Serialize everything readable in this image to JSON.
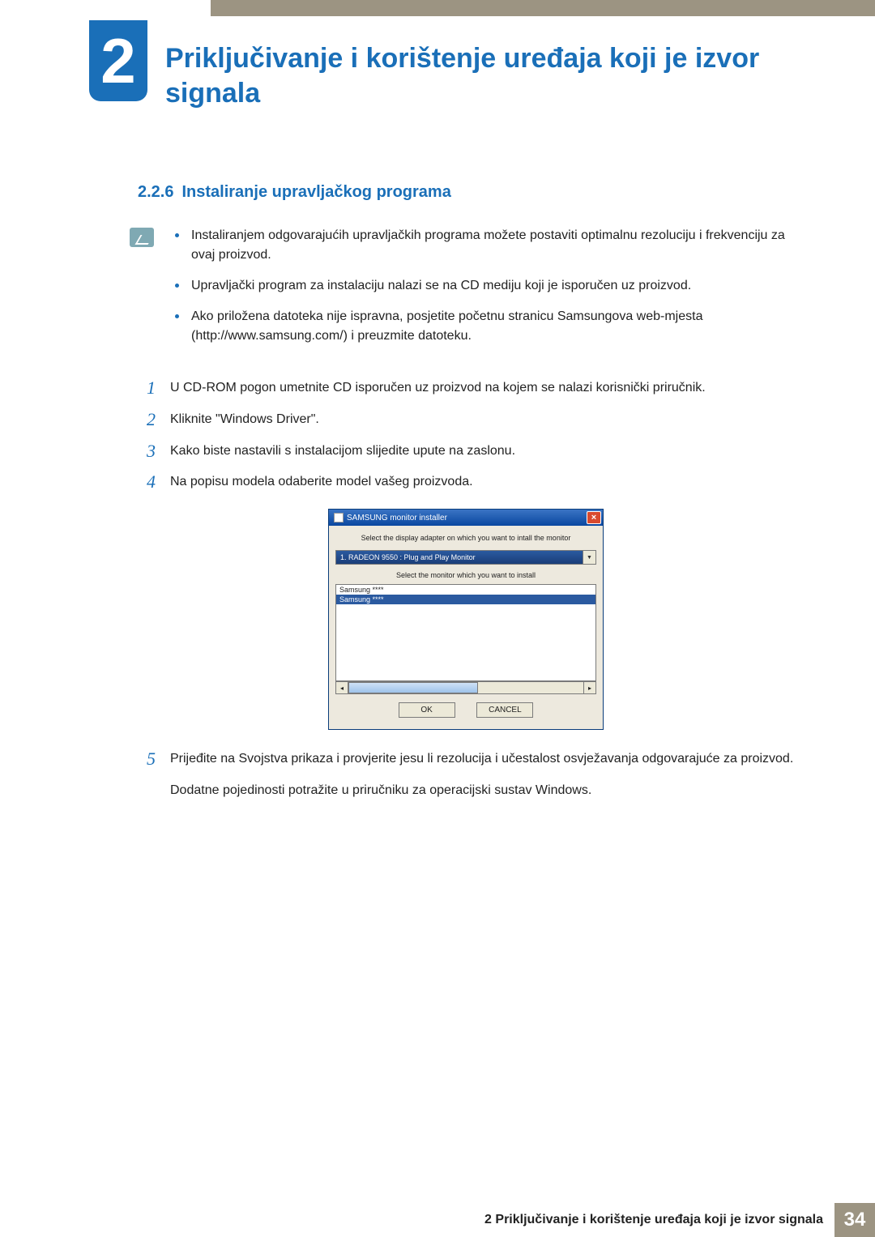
{
  "chapter": {
    "number": "2",
    "title": "Priključivanje i korištenje uređaja koji je izvor signala"
  },
  "section": {
    "number": "2.2.6",
    "title": "Instaliranje upravljačkog programa"
  },
  "note_bullets": [
    "Instaliranjem odgovarajućih upravljačkih programa možete postaviti optimalnu rezoluciju i frekvenciju za ovaj proizvod.",
    "Upravljački program za instalaciju nalazi se na CD mediju koji je isporučen uz proizvod.",
    "Ako priložena datoteka nije ispravna, posjetite početnu stranicu Samsungova web-mjesta (http://www.samsung.com/) i preuzmite datoteku."
  ],
  "steps": [
    {
      "n": "1",
      "text": "U CD-ROM pogon umetnite CD isporučen uz proizvod na kojem se nalazi korisnički priručnik."
    },
    {
      "n": "2",
      "text": "Kliknite \"Windows Driver\"."
    },
    {
      "n": "3",
      "text": "Kako biste nastavili s instalacijom slijedite upute na zaslonu."
    },
    {
      "n": "4",
      "text": "Na popisu modela odaberite model vašeg proizvoda."
    },
    {
      "n": "5",
      "text": "Prijeđite na Svojstva prikaza i provjerite jesu li rezolucija i učestalost osvježavanja odgovarajuće za proizvod."
    },
    {
      "n": "",
      "text": "Dodatne pojedinosti potražite u priručniku za operacijski sustav Windows."
    }
  ],
  "installer": {
    "title": "SAMSUNG monitor installer",
    "label1": "Select the display adapter on which you want to intall the monitor",
    "select_value": "1. RADEON 9550 : Plug and Play Monitor",
    "label2": "Select the monitor which you want to install",
    "list": [
      "Samsung ****",
      "Samsung ****"
    ],
    "ok": "OK",
    "cancel": "CANCEL"
  },
  "footer": {
    "text": "2 Priključivanje i korištenje uređaja koji je izvor signala",
    "page": "34"
  }
}
